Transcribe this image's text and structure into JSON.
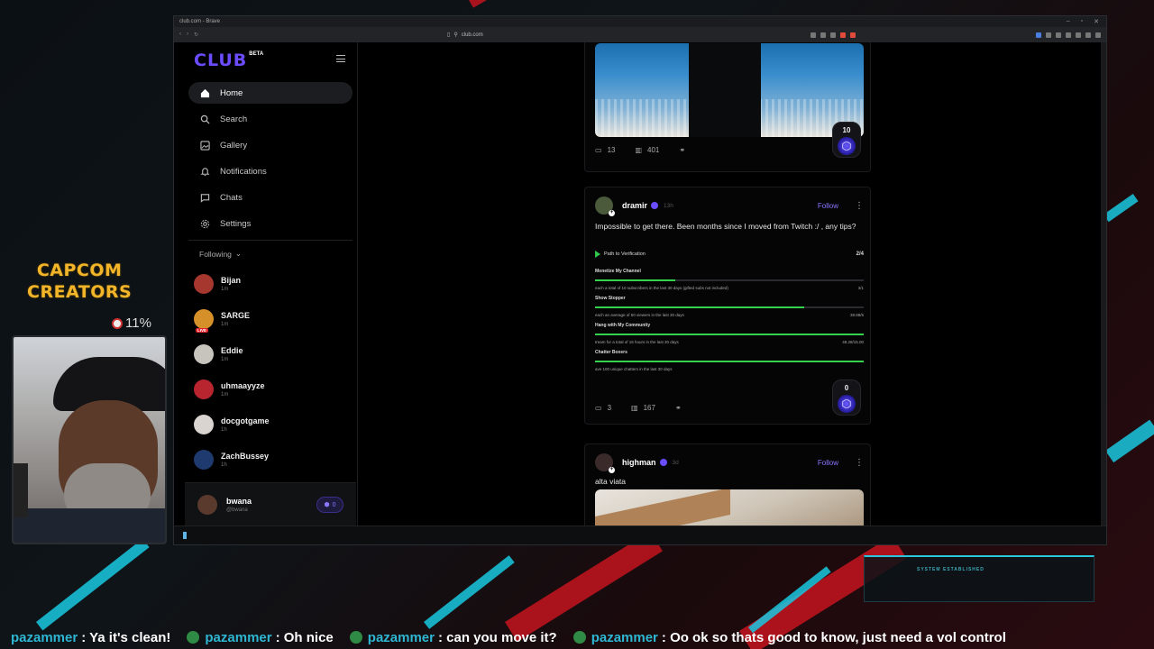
{
  "browser": {
    "tab_title": "club.com - Brave",
    "url": "club.com"
  },
  "sidebar": {
    "logo": "CLUB",
    "beta": "BETA",
    "nav": [
      {
        "label": "Home",
        "icon": "home-icon"
      },
      {
        "label": "Search",
        "icon": "search-icon"
      },
      {
        "label": "Gallery",
        "icon": "gallery-icon"
      },
      {
        "label": "Notifications",
        "icon": "bell-icon"
      },
      {
        "label": "Chats",
        "icon": "chat-icon"
      },
      {
        "label": "Settings",
        "icon": "gear-icon"
      }
    ],
    "following_label": "Following",
    "following": [
      {
        "name": "Bijan",
        "sub": "1m"
      },
      {
        "name": "SARGE",
        "sub": "1m",
        "live": "LIVE"
      },
      {
        "name": "Eddie",
        "sub": "1m"
      },
      {
        "name": "uhmaayyze",
        "sub": "1m"
      },
      {
        "name": "docgotgame",
        "sub": "1h"
      },
      {
        "name": "ZachBussey",
        "sub": "1h"
      }
    ],
    "me": {
      "name": "bwana",
      "handle": "@bwana",
      "coins": "0"
    }
  },
  "feed": {
    "post1": {
      "comments": "13",
      "views": "401",
      "badge": "10"
    },
    "post2": {
      "author": "dramir",
      "time": "13h",
      "follow": "Follow",
      "text": "Impossible to get there. Been months since I moved from Twitch :/ , any tips?",
      "verification": {
        "title": "Path to Verification",
        "progress": "2/4",
        "tasks": [
          {
            "title": "Monetize My Channel",
            "desc": "each a total of 10 subscribers in the last 30 days (gifted subs not included)",
            "value": "3/1",
            "fill": 0.3
          },
          {
            "title": "Show Stopper",
            "desc": "each an average of 50 viewers in the last 30 days",
            "value": "38.88/5",
            "fill": 0.78
          },
          {
            "title": "Hang with My Community",
            "desc": "tream for a total of 15 hours in the last 30 days",
            "value": "48.28/15.00",
            "fill": 1.0
          },
          {
            "title": "Chatter Boxers",
            "desc": "ave 100 unique chatters in the last 30 days",
            "value": "",
            "fill": 1.0
          }
        ]
      },
      "comments": "3",
      "views": "167",
      "badge": "0"
    },
    "post3": {
      "author": "highman",
      "time": "3d",
      "follow": "Follow",
      "text": "alta viata"
    }
  },
  "overlay": {
    "capcom_line1": "CAPCOM",
    "capcom_line2": "CREATORS",
    "percent": "11%",
    "system": "SYSTEM ESTABLISHED",
    "chat": [
      {
        "user": "pazammer",
        "msg": "Ya it's clean!"
      },
      {
        "user": "pazammer",
        "msg": "Oh nice"
      },
      {
        "user": "pazammer",
        "msg": "can you move it?"
      },
      {
        "user": "pazammer",
        "msg": "Oo ok so thats good to know, just need a vol control"
      }
    ]
  }
}
